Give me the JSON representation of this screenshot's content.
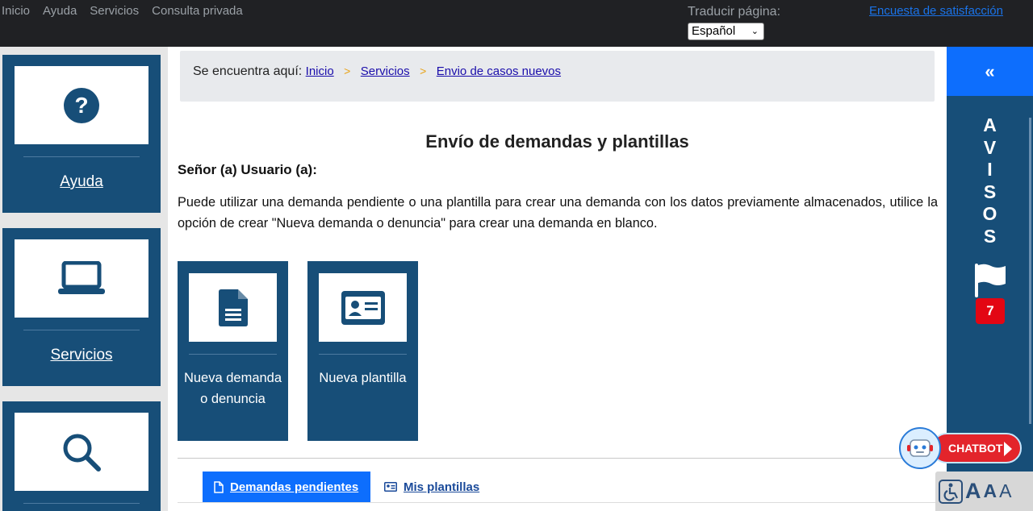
{
  "topbar": {
    "nav": [
      "Inicio",
      "Ayuda",
      "Servicios",
      "Consulta privada"
    ],
    "translate_label": "Traducir página:",
    "language_selected": "Español",
    "survey_link": "Encuesta de satisfacción"
  },
  "sidebar": {
    "items": [
      {
        "label": "Ayuda",
        "icon": "question-circle-icon"
      },
      {
        "label": "Servicios",
        "icon": "laptop-icon"
      },
      {
        "label": "",
        "icon": "search-icon"
      }
    ]
  },
  "breadcrumb": {
    "prefix": "Se encuentra aquí:",
    "items": [
      "Inicio",
      "Servicios",
      "Envio de casos nuevos"
    ],
    "separator": ">"
  },
  "main": {
    "title": "Envío de demandas y plantillas",
    "greeting": "Señor (a) Usuario (a):",
    "intro": "Puede utilizar una demanda pendiente o una plantilla para crear una demanda con los datos previamente almacenados, utilice la opción de crear \"Nueva demanda o denuncia\" para crear una demanda en blanco.",
    "actions": [
      {
        "label": "Nueva demanda o denuncia",
        "icon": "document-icon"
      },
      {
        "label": "Nueva plantilla",
        "icon": "id-card-icon"
      }
    ],
    "tabs": [
      {
        "label": "Demandas pendientes",
        "icon": "file-icon",
        "active": true
      },
      {
        "label": "Mis plantillas",
        "icon": "id-card-icon",
        "active": false
      }
    ]
  },
  "avisos": {
    "collapse_label": "«",
    "letters": [
      "A",
      "V",
      "I",
      "S",
      "O",
      "S"
    ],
    "count": "7"
  },
  "chatbot": {
    "label": "CHATBOT"
  },
  "accessibility": {
    "icon": "wheelchair-icon",
    "increase": "A",
    "decrease": "A",
    "reset": "A"
  },
  "colors": {
    "primary_dark": "#174e78",
    "accent_blue": "#0d6efd",
    "badge_red": "#e30613",
    "topbar": "#202124"
  }
}
